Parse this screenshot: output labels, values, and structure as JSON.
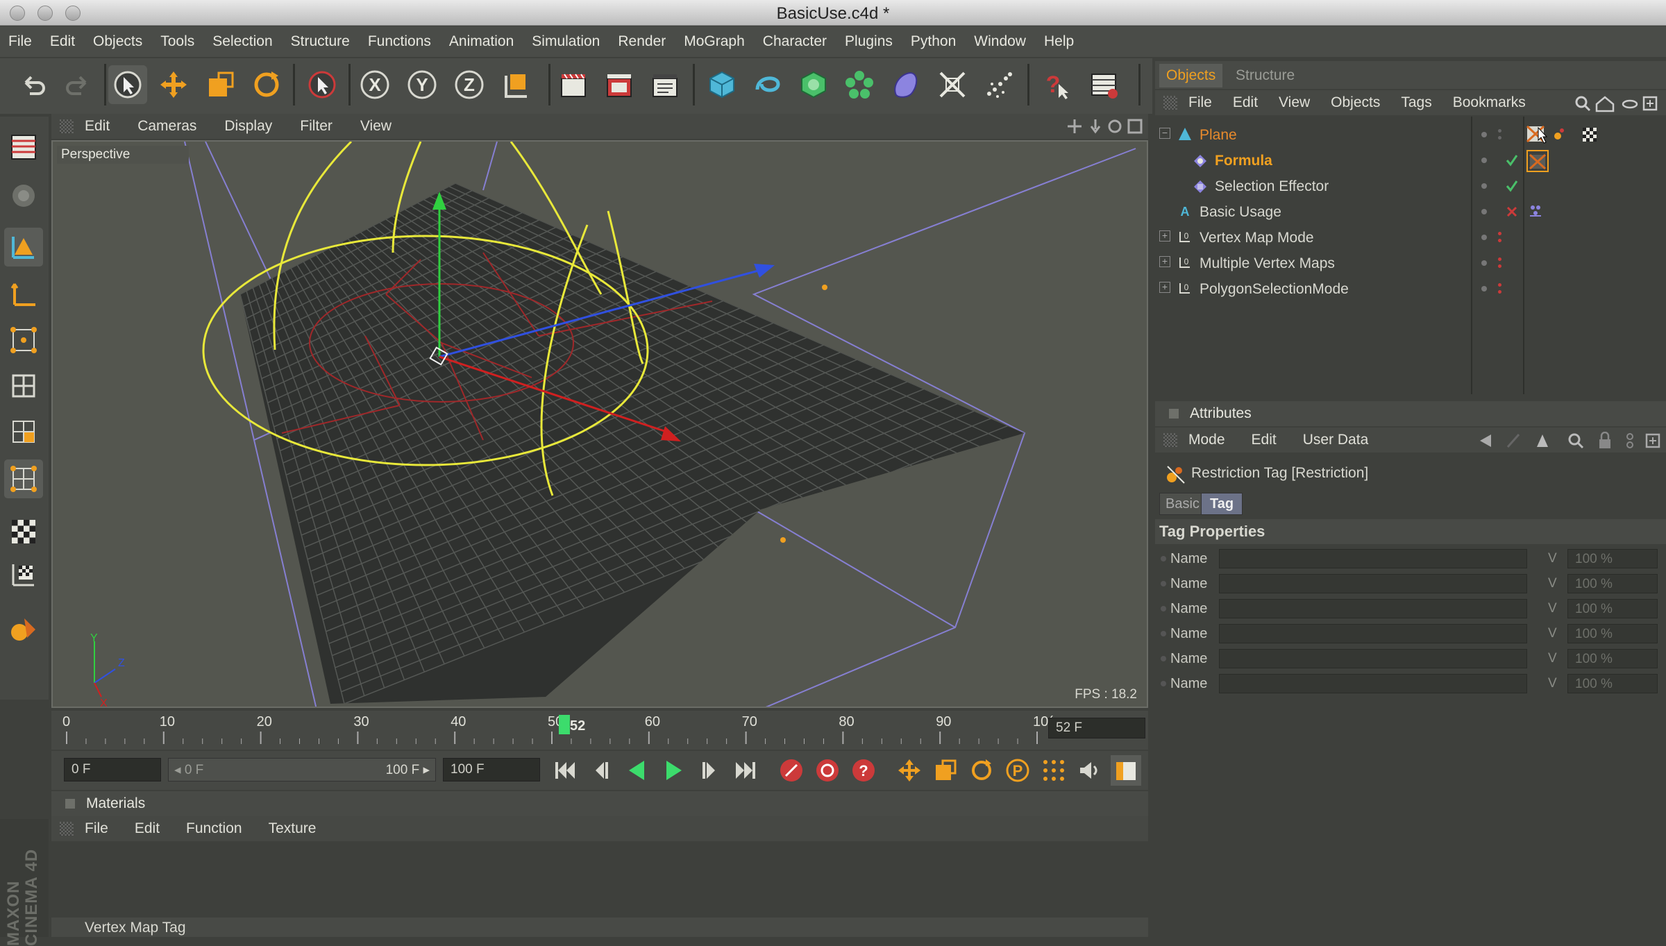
{
  "window": {
    "title": "BasicUse.c4d *"
  },
  "menubar": [
    "File",
    "Edit",
    "Objects",
    "Tools",
    "Selection",
    "Structure",
    "Functions",
    "Animation",
    "Simulation",
    "Render",
    "MoGraph",
    "Character",
    "Plugins",
    "Python",
    "Window",
    "Help"
  ],
  "toolbar": {
    "icons": [
      "undo-icon",
      "redo-icon",
      "live-select-icon",
      "move-icon",
      "scale-icon",
      "rotate-icon",
      "select-icon",
      "x-axis-icon",
      "y-axis-icon",
      "z-axis-icon",
      "coordinate-system-icon",
      "render-view-icon",
      "render-picture-viewer-icon",
      "render-settings-icon",
      "cube-icon",
      "spline-icon",
      "nurbs-icon",
      "array-icon",
      "deformer-icon",
      "scene-icon",
      "particle-icon",
      "help-icon",
      "layout-icon"
    ]
  },
  "viewport": {
    "menu": [
      "Edit",
      "Cameras",
      "Display",
      "Filter",
      "View"
    ],
    "label": "Perspective",
    "fps": "FPS : 18.2",
    "axis_labels": {
      "y": "Y",
      "z": "Z",
      "x": "X"
    }
  },
  "timeline": {
    "ticks": [
      "0",
      "10",
      "20",
      "30",
      "40",
      "50",
      "60",
      "70",
      "80",
      "90",
      "10("
    ],
    "current_frame_label": "52",
    "current_frame": 52,
    "max_frame": 100,
    "frame_field": "52 F"
  },
  "transport": {
    "start_field": "0 F",
    "range_start": "◂ 0 F",
    "range_end": "100 F ▸",
    "end_field": "100 F"
  },
  "materials": {
    "title": "Materials",
    "menu": [
      "File",
      "Edit",
      "Function",
      "Texture"
    ]
  },
  "bottom_panel": {
    "title": "Vertex Map Tag"
  },
  "branding": {
    "line1": "MAXON",
    "line2": "CINEMA 4D"
  },
  "objects_panel": {
    "tabs": [
      "Objects",
      "Structure"
    ],
    "menu": [
      "File",
      "Edit",
      "View",
      "Objects",
      "Tags",
      "Bookmarks"
    ],
    "items": [
      {
        "name": "Plane",
        "color": "#e88a2c"
      },
      {
        "name": "Formula",
        "color": "#f0a020"
      },
      {
        "name": "Selection Effector",
        "color": "#d8d8d0"
      },
      {
        "name": "Basic Usage",
        "color": "#d8d8d0"
      },
      {
        "name": "Vertex Map Mode",
        "color": "#d8d8d0"
      },
      {
        "name": "Multiple Vertex Maps",
        "color": "#d8d8d0"
      },
      {
        "name": "PolygonSelectionMode",
        "color": "#d8d8d0"
      }
    ]
  },
  "attributes_panel": {
    "title": "Attributes",
    "menu": [
      "Mode",
      "Edit",
      "User Data"
    ],
    "object_title": "Restriction Tag [Restriction]",
    "tabs": [
      "Basic",
      "Tag"
    ],
    "section": "Tag Properties",
    "rows": [
      {
        "name": "Name",
        "v": "V",
        "pct": "100 %"
      },
      {
        "name": "Name",
        "v": "V",
        "pct": "100 %"
      },
      {
        "name": "Name",
        "v": "V",
        "pct": "100 %"
      },
      {
        "name": "Name",
        "v": "V",
        "pct": "100 %"
      },
      {
        "name": "Name",
        "v": "V",
        "pct": "100 %"
      },
      {
        "name": "Name",
        "v": "V",
        "pct": "100 %"
      }
    ]
  },
  "colors": {
    "accent": "#e88a2c",
    "selection_yellow": "#e8e83a",
    "grid": "#3a3c3a",
    "active_frame": "#3cdc6c"
  }
}
